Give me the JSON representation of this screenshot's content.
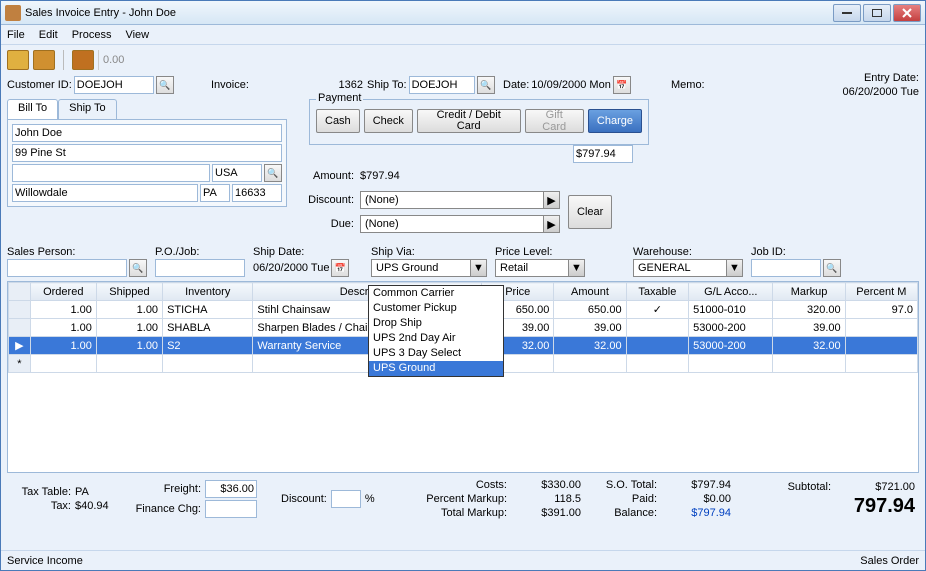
{
  "window": {
    "title": "Sales Invoice Entry - John Doe"
  },
  "menu": [
    "File",
    "Edit",
    "Process",
    "View"
  ],
  "toolbar": {
    "amount": "0.00"
  },
  "header": {
    "customer_id_label": "Customer ID:",
    "customer_id": "DOEJOH",
    "invoice_label": "Invoice:",
    "invoice": "1362",
    "ship_to_label": "Ship To:",
    "ship_to": "DOEJOH",
    "date_label": "Date:",
    "date": "10/09/2000 Mon",
    "memo_label": "Memo:",
    "entry_date_label": "Entry Date:",
    "entry_date": "06/20/2000 Tue"
  },
  "billto": {
    "tabs": [
      "Bill To",
      "Ship To"
    ],
    "name": "John Doe",
    "street": "99 Pine St",
    "country": "USA",
    "city": "Willowdale",
    "state": "PA",
    "zip": "16633"
  },
  "payment": {
    "legend": "Payment",
    "buttons": [
      "Cash",
      "Check",
      "Credit / Debit Card",
      "Gift Card",
      "Charge"
    ],
    "charge_amount": "$797.94",
    "amount_label": "Amount:",
    "amount": "$797.94",
    "discount_label": "Discount:",
    "discount": "(None)",
    "due_label": "Due:",
    "due": "(None)",
    "clear_label": "Clear"
  },
  "mid": {
    "sales_person_label": "Sales Person:",
    "po_job_label": "P.O./Job:",
    "ship_date_label": "Ship Date:",
    "ship_date": "06/20/2000 Tue",
    "ship_via_label": "Ship Via:",
    "ship_via": "UPS Ground",
    "ship_via_options": [
      "Common Carrier",
      "Customer Pickup",
      "Drop Ship",
      "UPS 2nd Day Air",
      "UPS 3 Day Select",
      "UPS Ground"
    ],
    "ship_via_selected_index": 5,
    "price_level_label": "Price Level:",
    "price_level": "Retail",
    "warehouse_label": "Warehouse:",
    "warehouse": "GENERAL",
    "job_id_label": "Job ID:"
  },
  "grid": {
    "headers": [
      "Ordered",
      "Shipped",
      "Inventory",
      "Description",
      "Price",
      "Amount",
      "Taxable",
      "G/L Acco...",
      "Markup",
      "Percent M"
    ],
    "rows": [
      {
        "ordered": "1.00",
        "shipped": "1.00",
        "inventory": "STICHA",
        "description": "Stihl Chainsaw",
        "price": "650.00",
        "amount": "650.00",
        "taxable": true,
        "gl": "51000-010",
        "markup": "320.00",
        "percentm": "97.0"
      },
      {
        "ordered": "1.00",
        "shipped": "1.00",
        "inventory": "SHABLA",
        "description": "Sharpen Blades /  Chains",
        "price": "39.00",
        "amount": "39.00",
        "taxable": false,
        "gl": "53000-200",
        "markup": "39.00",
        "percentm": ""
      },
      {
        "ordered": "1.00",
        "shipped": "1.00",
        "inventory": "S2",
        "description": "Warranty Service",
        "price": "32.00",
        "amount": "32.00",
        "taxable": false,
        "gl": "53000-200",
        "markup": "32.00",
        "percentm": "",
        "selected": true
      }
    ]
  },
  "totals": {
    "tax_table_label": "Tax Table:",
    "tax_table": "PA",
    "tax_label": "Tax:",
    "tax": "$40.94",
    "freight_label": "Freight:",
    "freight": "$36.00",
    "finance_chg_label": "Finance Chg:",
    "discount_label": "Discount:",
    "percent": "%",
    "costs_label": "Costs:",
    "costs": "$330.00",
    "percent_markup_label": "Percent Markup:",
    "percent_markup": "118.5",
    "total_markup_label": "Total Markup:",
    "total_markup": "$391.00",
    "so_total_label": "S.O. Total:",
    "so_total": "$797.94",
    "paid_label": "Paid:",
    "paid": "$0.00",
    "balance_label": "Balance:",
    "balance": "$797.94",
    "subtotal_label": "Subtotal:",
    "subtotal": "$721.00",
    "grand": "797.94"
  },
  "status": {
    "left": "Service Income",
    "right": "Sales Order"
  }
}
